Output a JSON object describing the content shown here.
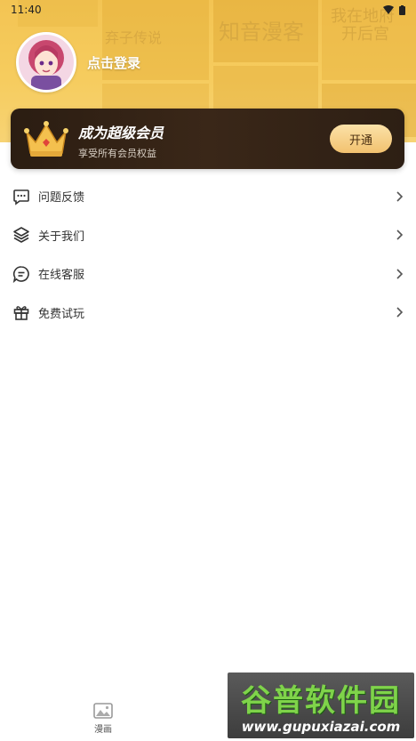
{
  "status_bar": {
    "time": "11:40"
  },
  "header": {
    "login_label": "点击登录",
    "background_colors": [
      "#f3c453",
      "#f7d374"
    ]
  },
  "vip_card": {
    "title": "成为超级会员",
    "subtitle": "享受所有会员权益",
    "button_label": "开通",
    "accent": "#f2c26f"
  },
  "menu": {
    "items": [
      {
        "label": "问题反馈",
        "icon": "message-icon"
      },
      {
        "label": "关于我们",
        "icon": "layers-icon"
      },
      {
        "label": "在线客服",
        "icon": "chat-icon"
      },
      {
        "label": "免费试玩",
        "icon": "gift-icon"
      }
    ]
  },
  "bottom_nav": {
    "items": [
      {
        "label": "漫画",
        "icon": "image-icon"
      }
    ]
  },
  "watermark": {
    "title": "谷普软件园",
    "url": "www.gupuxiazai.com"
  }
}
